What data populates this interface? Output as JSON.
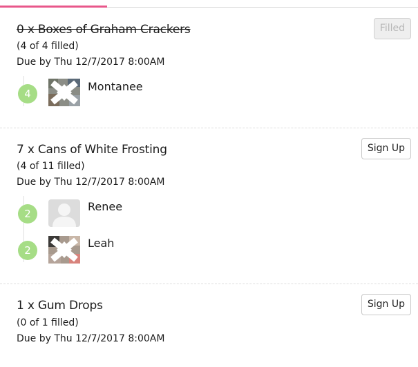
{
  "items": [
    {
      "title": "0 x Boxes of Graham Crackers",
      "filled_text": "(4 of 4 filled)",
      "due_text": "Due by Thu 12/7/2017 8:00AM",
      "button_label": "Filled",
      "signups": [
        {
          "count": "4",
          "name": "Montanee",
          "avatar": "photo-avatar"
        }
      ]
    },
    {
      "title": "7 x Cans of White Frosting",
      "filled_text": "(4 of 11 filled)",
      "due_text": "Due by Thu 12/7/2017 8:00AM",
      "button_label": "Sign Up",
      "signups": [
        {
          "count": "2",
          "name": "Renee",
          "avatar": "default-person-avatar"
        },
        {
          "count": "2",
          "name": "Leah",
          "avatar": "photo-avatar"
        }
      ]
    },
    {
      "title": "1 x Gum Drops",
      "filled_text": "(0 of 1 filled)",
      "due_text": "Due by Thu 12/7/2017 8:00AM",
      "button_label": "Sign Up",
      "signups": []
    }
  ],
  "colors": {
    "accent": "#e8578a",
    "count_badge": "#a6dd86",
    "separator": "#dcdcdc",
    "disabled_button_bg": "#eeeeee"
  }
}
